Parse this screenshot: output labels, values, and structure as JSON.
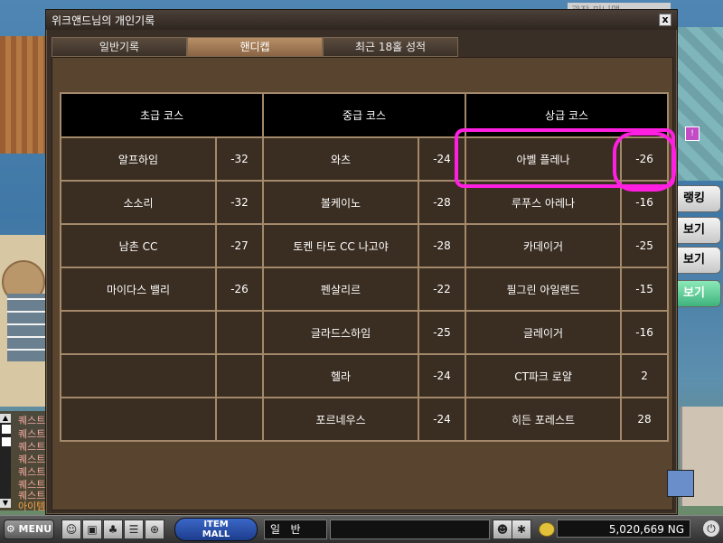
{
  "window": {
    "title": "위크앤드님의 개인기록",
    "close_glyph": "x"
  },
  "tabs": [
    {
      "label": "일반기록"
    },
    {
      "label": "핸디캡"
    },
    {
      "label": "최근 18홀 성적"
    }
  ],
  "table": {
    "headers": [
      "초급 코스",
      "중급 코스",
      "상급 코스"
    ],
    "rows": [
      [
        {
          "name": "알프하임",
          "score": "-32"
        },
        {
          "name": "와츠",
          "score": "-24"
        },
        {
          "name": "아벨 플레나",
          "score": "-26"
        }
      ],
      [
        {
          "name": "소소리",
          "score": "-32"
        },
        {
          "name": "볼케이노",
          "score": "-28"
        },
        {
          "name": "루푸스 아레나",
          "score": "-16"
        }
      ],
      [
        {
          "name": "남촌 CC",
          "score": "-27"
        },
        {
          "name": "토켄 타도 CC 나고야",
          "score": "-28"
        },
        {
          "name": "카데이거",
          "score": "-25"
        }
      ],
      [
        {
          "name": "마이다스 밸리",
          "score": "-26"
        },
        {
          "name": "펜살리르",
          "score": "-22"
        },
        {
          "name": "필그린 아일랜드",
          "score": "-15"
        }
      ],
      [
        {
          "name": "",
          "score": ""
        },
        {
          "name": "글라드스하임",
          "score": "-25"
        },
        {
          "name": "글레이거",
          "score": "-16"
        }
      ],
      [
        {
          "name": "",
          "score": ""
        },
        {
          "name": "헬라",
          "score": "-24"
        },
        {
          "name": "CT파크 로얄",
          "score": "2"
        }
      ],
      [
        {
          "name": "",
          "score": ""
        },
        {
          "name": "포르네우스",
          "score": "-24"
        },
        {
          "name": "히든 포레스트",
          "score": "28"
        }
      ]
    ]
  },
  "side_buttons": [
    "랭킹",
    "보기",
    "보기",
    "보기"
  ],
  "side_map_title": "광장 미니맵",
  "quest_items": [
    "퀘스트",
    "퀘스트",
    "퀘스트",
    "퀘스트",
    "퀘스트",
    "퀘스트",
    "퀘스트",
    "아이템"
  ],
  "bottom_bar": {
    "menu_label": "MENU",
    "itemmall_line1": "ITEM",
    "itemmall_line2": "MALL",
    "chat_mode": "일   반",
    "money": "5,020,669 NG"
  },
  "colors": {
    "highlight": "#ff1fe0",
    "window_bg": "#3a2f26",
    "cell_bg": "#3a2d21",
    "header_bg": "#000000",
    "grid_border": "#a4896a"
  }
}
